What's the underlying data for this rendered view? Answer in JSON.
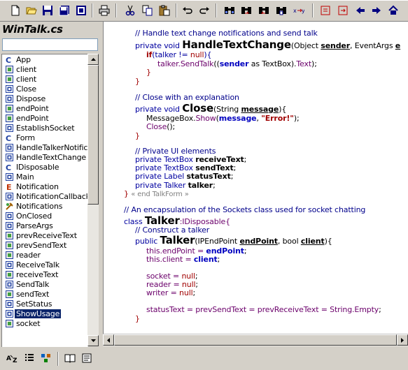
{
  "toolbar": {
    "icons": [
      "new-document-icon",
      "open-folder-icon",
      "save-icon",
      "save-all-icon",
      "save-as-icon",
      "print-icon",
      "cut-icon",
      "copy-icon",
      "paste-icon",
      "undo-icon",
      "redo-icon",
      "find-icon",
      "find-next-icon",
      "find-previous-icon",
      "replace-icon",
      "goto-icon",
      "bookmark-icon",
      "bookmark-next-icon",
      "back-icon",
      "forward-icon",
      "home-icon"
    ]
  },
  "file_title": "WinTalk.cs",
  "filter": {
    "value": "",
    "placeholder": ""
  },
  "members": [
    {
      "label": "App",
      "icon": "class-icon"
    },
    {
      "label": "client",
      "icon": "field-icon"
    },
    {
      "label": "client",
      "icon": "field-icon"
    },
    {
      "label": "Close",
      "icon": "method-icon"
    },
    {
      "label": "Dispose",
      "icon": "method-icon"
    },
    {
      "label": "endPoint",
      "icon": "field-icon"
    },
    {
      "label": "endPoint",
      "icon": "field-icon"
    },
    {
      "label": "EstablishSocket",
      "icon": "method-icon"
    },
    {
      "label": "Form",
      "icon": "class-icon"
    },
    {
      "label": "HandleTalkerNotifica",
      "icon": "method-icon"
    },
    {
      "label": "HandleTextChange",
      "icon": "method-icon"
    },
    {
      "label": "IDisposable",
      "icon": "class-icon"
    },
    {
      "label": "Main",
      "icon": "method-icon"
    },
    {
      "label": "Notification",
      "icon": "enum-icon"
    },
    {
      "label": "NotificationCallback",
      "icon": "method-icon"
    },
    {
      "label": "Notifications",
      "icon": "property-icon"
    },
    {
      "label": "OnClosed",
      "icon": "method-icon"
    },
    {
      "label": "ParseArgs",
      "icon": "method-icon"
    },
    {
      "label": "prevReceiveText",
      "icon": "field-icon"
    },
    {
      "label": "prevSendText",
      "icon": "field-icon"
    },
    {
      "label": "reader",
      "icon": "field-icon"
    },
    {
      "label": "ReceiveTalk",
      "icon": "method-icon"
    },
    {
      "label": "receiveText",
      "icon": "field-icon"
    },
    {
      "label": "SendTalk",
      "icon": "method-icon"
    },
    {
      "label": "sendText",
      "icon": "field-icon"
    },
    {
      "label": "SetStatus",
      "icon": "method-icon"
    },
    {
      "label": "ShowUsage",
      "icon": "method-icon",
      "selected": true
    },
    {
      "label": "socket",
      "icon": "field-icon"
    }
  ],
  "bottom_tools": [
    "sort-alpha-icon",
    "sort-list-icon",
    "category-icon",
    "book-icon",
    "properties-icon"
  ],
  "code": {
    "l1": "// Handle text change notifications and send talk",
    "l2a": "private void ",
    "l2b": "HandleTextChange",
    "l2c": "(Object ",
    "l2d": "sender",
    "l2e": ", EventArgs ",
    "l2f": "e",
    "l3a": "if",
    "l3b": "(talker != ",
    "l3c": "null",
    "l3d": "){",
    "l4a": "talker.SendTalk",
    "l4b": "((",
    "l4c": "sender",
    "l4d": " as TextBox).",
    "l4e": "Text",
    "l4f": ");",
    "l5": "}",
    "l6": "}",
    "l7": "// Close with an explanation",
    "l8a": "private void ",
    "l8b": "Close",
    "l8c": "(String ",
    "l8d": "message",
    "l8e": "){",
    "l9a": "MessageBox.",
    "l9b": "Show",
    "l9c": "(",
    "l9d": "message",
    "l9e": ", ",
    "l9f": "\"Error!\"",
    "l9g": ");",
    "l10a": "Close",
    "l10b": "();",
    "l11": "}",
    "l12": "// Private UI elements",
    "l13a": "private TextBox ",
    "l13b": "receiveText",
    "l13c": ";",
    "l14a": "private TextBox ",
    "l14b": "sendText",
    "l14c": ";",
    "l15a": "private Label ",
    "l15b": "statusText",
    "l15c": ";",
    "l16a": "private Talker ",
    "l16b": "talker",
    "l16c": ";",
    "l17a": "} ",
    "l17b": "« end TalkForm »",
    "l18": "// An encapsulation of the Sockets class used for socket chatting",
    "l19a": "class ",
    "l19b": "Talker",
    "l19c": ":IDisposable{",
    "l20": "// Construct a talker",
    "l21a": "public ",
    "l21b": "Talker",
    "l21c": "(IPEndPoint ",
    "l21d": "endPoint",
    "l21e": ", bool ",
    "l21f": "client",
    "l21g": "){",
    "l22a": "this.endPoint = ",
    "l22b": "endPoint",
    "l22c": ";",
    "l23a": "this.client = ",
    "l23b": "client",
    "l23c": ";",
    "l24a": "socket = ",
    "l24b": "null",
    "l24c": ";",
    "l25a": "reader = ",
    "l25b": "null",
    "l25c": ";",
    "l26a": "writer = ",
    "l26b": "null",
    "l26c": ";",
    "l27a": "statusText = prevSendText = prevReceiveText = String.",
    "l27b": "Empty",
    "l27c": ";",
    "l28": "}"
  }
}
